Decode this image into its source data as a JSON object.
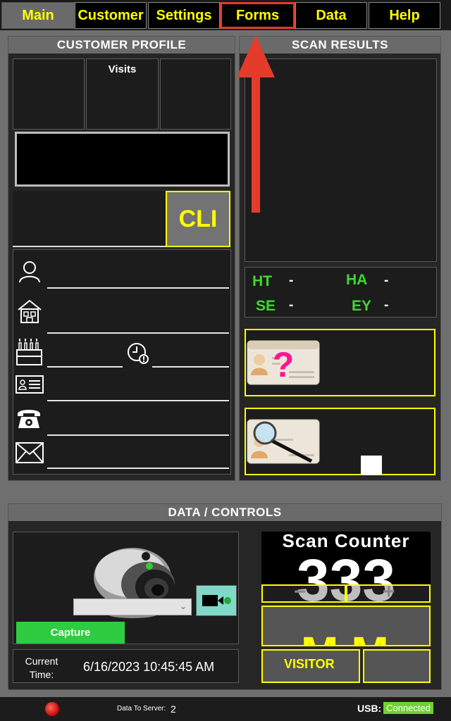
{
  "tabs": [
    {
      "label": "Main"
    },
    {
      "label": "Customer"
    },
    {
      "label": "Settings"
    },
    {
      "label": "Forms"
    },
    {
      "label": "Data"
    },
    {
      "label": "Help"
    }
  ],
  "profile": {
    "title": "CUSTOMER PROFILE",
    "visits_label": "Visits",
    "cli_label": "CLI"
  },
  "scan": {
    "title": "SCAN RESULTS",
    "ht": "HT",
    "ha": "HA",
    "se": "SE",
    "ey": "EY",
    "dash": "-"
  },
  "controls": {
    "title": "DATA / CONTROLS",
    "capture_label": "Capture",
    "current_time_label": "Current Time:",
    "current_time_value": "6/16/2023 10:45:45 AM",
    "scan_counter_label": "Scan Counter",
    "scan_counter_value": "333",
    "minus": "−",
    "plus": "+",
    "status_glyph": "MM",
    "visitor_label": "VISITOR"
  },
  "status": {
    "data_to_server_label": "Data To Server:",
    "data_to_server_value": "2",
    "usb_label": "USB:",
    "usb_value": "Connected"
  },
  "colors": {
    "accent_yellow": "#ffff00",
    "annotation_red": "#e53b2b",
    "green_text": "#3adb2a",
    "capture_green": "#2ecc40"
  }
}
